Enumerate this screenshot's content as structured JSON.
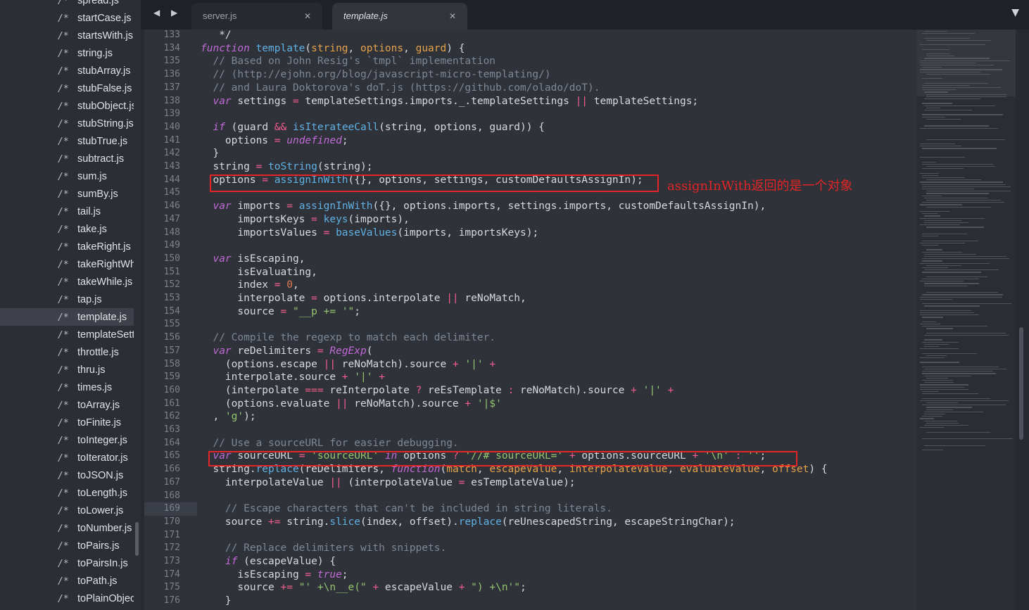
{
  "sidebar": {
    "items": [
      {
        "icon": "/*",
        "label": "spread.js"
      },
      {
        "icon": "/*",
        "label": "startCase.js"
      },
      {
        "icon": "/*",
        "label": "startsWith.js"
      },
      {
        "icon": "/*",
        "label": "string.js"
      },
      {
        "icon": "/*",
        "label": "stubArray.js"
      },
      {
        "icon": "/*",
        "label": "stubFalse.js"
      },
      {
        "icon": "/*",
        "label": "stubObject.js"
      },
      {
        "icon": "/*",
        "label": "stubString.js"
      },
      {
        "icon": "/*",
        "label": "stubTrue.js"
      },
      {
        "icon": "/*",
        "label": "subtract.js"
      },
      {
        "icon": "/*",
        "label": "sum.js"
      },
      {
        "icon": "/*",
        "label": "sumBy.js"
      },
      {
        "icon": "/*",
        "label": "tail.js"
      },
      {
        "icon": "/*",
        "label": "take.js"
      },
      {
        "icon": "/*",
        "label": "takeRight.js"
      },
      {
        "icon": "/*",
        "label": "takeRightWhile.js"
      },
      {
        "icon": "/*",
        "label": "takeWhile.js"
      },
      {
        "icon": "/*",
        "label": "tap.js"
      },
      {
        "icon": "/*",
        "label": "template.js",
        "active": true
      },
      {
        "icon": "/*",
        "label": "templateSettings.js"
      },
      {
        "icon": "/*",
        "label": "throttle.js"
      },
      {
        "icon": "/*",
        "label": "thru.js"
      },
      {
        "icon": "/*",
        "label": "times.js"
      },
      {
        "icon": "/*",
        "label": "toArray.js"
      },
      {
        "icon": "/*",
        "label": "toFinite.js"
      },
      {
        "icon": "/*",
        "label": "toInteger.js"
      },
      {
        "icon": "/*",
        "label": "toIterator.js"
      },
      {
        "icon": "/*",
        "label": "toJSON.js"
      },
      {
        "icon": "/*",
        "label": "toLength.js"
      },
      {
        "icon": "/*",
        "label": "toLower.js"
      },
      {
        "icon": "/*",
        "label": "toNumber.js"
      },
      {
        "icon": "/*",
        "label": "toPairs.js"
      },
      {
        "icon": "/*",
        "label": "toPairsIn.js"
      },
      {
        "icon": "/*",
        "label": "toPath.js"
      },
      {
        "icon": "/*",
        "label": "toPlainObject.js"
      }
    ]
  },
  "tabs": {
    "nav": "◀ ▶",
    "items": [
      {
        "label": "server.js",
        "close": "✕"
      },
      {
        "label": "template.js",
        "close": "✕",
        "active": true
      }
    ],
    "dropdown": "▼"
  },
  "editor": {
    "current_line": 169,
    "lines": [
      {
        "n": 133,
        "t": [
          [
            "",
            "   */"
          ]
        ]
      },
      {
        "n": 134,
        "t": [
          [
            "kw",
            "function"
          ],
          [
            "",
            " "
          ],
          [
            "fn",
            "template"
          ],
          [
            "",
            "("
          ],
          [
            "pa",
            "string"
          ],
          [
            "",
            ", "
          ],
          [
            "pa",
            "options"
          ],
          [
            "",
            ", "
          ],
          [
            "pa",
            "guard"
          ],
          [
            "",
            ") {"
          ]
        ]
      },
      {
        "n": 135,
        "t": [
          [
            "cm",
            "  // Based on John Resig's `tmpl` implementation"
          ]
        ]
      },
      {
        "n": 136,
        "t": [
          [
            "cm",
            "  // (http://ejohn.org/blog/javascript-micro-templating/)"
          ]
        ]
      },
      {
        "n": 137,
        "t": [
          [
            "cm",
            "  // and Laura Doktorova's doT.js (https://github.com/olado/doT)."
          ]
        ]
      },
      {
        "n": 138,
        "t": [
          [
            "",
            "  "
          ],
          [
            "kw",
            "var"
          ],
          [
            "",
            " settings "
          ],
          [
            "op",
            "="
          ],
          [
            "",
            " templateSettings.imports._.templateSettings "
          ],
          [
            "op",
            "||"
          ],
          [
            "",
            " templateSettings;"
          ]
        ]
      },
      {
        "n": 139,
        "t": []
      },
      {
        "n": 140,
        "t": [
          [
            "",
            "  "
          ],
          [
            "kw",
            "if"
          ],
          [
            "",
            " (guard "
          ],
          [
            "op",
            "&&"
          ],
          [
            "",
            " "
          ],
          [
            "fn",
            "isIterateeCall"
          ],
          [
            "",
            "(string, options, guard)) {"
          ]
        ]
      },
      {
        "n": 141,
        "t": [
          [
            "",
            "    options "
          ],
          [
            "op",
            "="
          ],
          [
            "",
            " "
          ],
          [
            "kw",
            "undefined"
          ],
          [
            "",
            ";"
          ]
        ]
      },
      {
        "n": 142,
        "t": [
          [
            "",
            "  }"
          ]
        ]
      },
      {
        "n": 143,
        "t": [
          [
            "",
            "  string "
          ],
          [
            "op",
            "="
          ],
          [
            "",
            " "
          ],
          [
            "fn",
            "toString"
          ],
          [
            "",
            "(string);"
          ]
        ]
      },
      {
        "n": 144,
        "t": [
          [
            "",
            "  options "
          ],
          [
            "op",
            "="
          ],
          [
            "",
            " "
          ],
          [
            "fn",
            "assignInWith"
          ],
          [
            "",
            "({}, options, settings, customDefaultsAssignIn);"
          ]
        ]
      },
      {
        "n": 145,
        "t": []
      },
      {
        "n": 146,
        "t": [
          [
            "",
            "  "
          ],
          [
            "kw",
            "var"
          ],
          [
            "",
            " imports "
          ],
          [
            "op",
            "="
          ],
          [
            "",
            " "
          ],
          [
            "fn",
            "assignInWith"
          ],
          [
            "",
            "({}, options.imports, settings.imports, customDefaultsAssignIn),"
          ]
        ]
      },
      {
        "n": 147,
        "t": [
          [
            "",
            "      importsKeys "
          ],
          [
            "op",
            "="
          ],
          [
            "",
            " "
          ],
          [
            "fn",
            "keys"
          ],
          [
            "",
            "(imports),"
          ]
        ]
      },
      {
        "n": 148,
        "t": [
          [
            "",
            "      importsValues "
          ],
          [
            "op",
            "="
          ],
          [
            "",
            " "
          ],
          [
            "fn",
            "baseValues"
          ],
          [
            "",
            "(imports, importsKeys);"
          ]
        ]
      },
      {
        "n": 149,
        "t": []
      },
      {
        "n": 150,
        "t": [
          [
            "",
            "  "
          ],
          [
            "kw",
            "var"
          ],
          [
            "",
            " isEscaping,"
          ]
        ]
      },
      {
        "n": 151,
        "t": [
          [
            "",
            "      isEvaluating,"
          ]
        ]
      },
      {
        "n": 152,
        "t": [
          [
            "",
            "      index "
          ],
          [
            "op",
            "="
          ],
          [
            "",
            " "
          ],
          [
            "nu",
            "0"
          ],
          [
            "",
            ","
          ]
        ]
      },
      {
        "n": 153,
        "t": [
          [
            "",
            "      interpolate "
          ],
          [
            "op",
            "="
          ],
          [
            "",
            " options.interpolate "
          ],
          [
            "op",
            "||"
          ],
          [
            "",
            " reNoMatch,"
          ]
        ]
      },
      {
        "n": 154,
        "t": [
          [
            "",
            "      source "
          ],
          [
            "op",
            "="
          ],
          [
            "",
            " "
          ],
          [
            "st",
            "\"__p += '\""
          ],
          [
            "",
            ";"
          ]
        ]
      },
      {
        "n": 155,
        "t": []
      },
      {
        "n": 156,
        "t": [
          [
            "cm",
            "  // Compile the regexp to match each delimiter."
          ]
        ]
      },
      {
        "n": 157,
        "t": [
          [
            "",
            "  "
          ],
          [
            "kw",
            "var"
          ],
          [
            "",
            " reDelimiters "
          ],
          [
            "op",
            "="
          ],
          [
            "",
            " "
          ],
          [
            "kw",
            "RegExp"
          ],
          [
            "",
            "("
          ]
        ]
      },
      {
        "n": 158,
        "t": [
          [
            "",
            "    (options.escape "
          ],
          [
            "op",
            "||"
          ],
          [
            "",
            " reNoMatch).source "
          ],
          [
            "op",
            "+"
          ],
          [
            "",
            " "
          ],
          [
            "st",
            "'|'"
          ],
          [
            "",
            " "
          ],
          [
            "op",
            "+"
          ]
        ]
      },
      {
        "n": 159,
        "t": [
          [
            "",
            "    interpolate.source "
          ],
          [
            "op",
            "+"
          ],
          [
            "",
            " "
          ],
          [
            "st",
            "'|'"
          ],
          [
            "",
            " "
          ],
          [
            "op",
            "+"
          ]
        ]
      },
      {
        "n": 160,
        "t": [
          [
            "",
            "    (interpolate "
          ],
          [
            "op",
            "==="
          ],
          [
            "",
            " reInterpolate "
          ],
          [
            "op",
            "?"
          ],
          [
            "",
            " reEsTemplate "
          ],
          [
            "op",
            ":"
          ],
          [
            "",
            " reNoMatch).source "
          ],
          [
            "op",
            "+"
          ],
          [
            "",
            " "
          ],
          [
            "st",
            "'|'"
          ],
          [
            "",
            " "
          ],
          [
            "op",
            "+"
          ]
        ]
      },
      {
        "n": 161,
        "t": [
          [
            "",
            "    (options.evaluate "
          ],
          [
            "op",
            "||"
          ],
          [
            "",
            " reNoMatch).source "
          ],
          [
            "op",
            "+"
          ],
          [
            "",
            " "
          ],
          [
            "st",
            "'|$'"
          ]
        ]
      },
      {
        "n": 162,
        "t": [
          [
            "",
            "  , "
          ],
          [
            "st",
            "'g'"
          ],
          [
            "",
            ");"
          ]
        ]
      },
      {
        "n": 163,
        "t": []
      },
      {
        "n": 164,
        "t": [
          [
            "cm",
            "  // Use a sourceURL for easier debugging."
          ]
        ]
      },
      {
        "n": 165,
        "t": [
          [
            "",
            "  "
          ],
          [
            "kw",
            "var"
          ],
          [
            "",
            " sourceURL "
          ],
          [
            "op",
            "="
          ],
          [
            "",
            " "
          ],
          [
            "st",
            "'sourceURL'"
          ],
          [
            "",
            " "
          ],
          [
            "kw",
            "in"
          ],
          [
            "",
            " options "
          ],
          [
            "op",
            "?"
          ],
          [
            "",
            " "
          ],
          [
            "st",
            "'//# sourceURL='"
          ],
          [
            "",
            " "
          ],
          [
            "op",
            "+"
          ],
          [
            "",
            " options.sourceURL "
          ],
          [
            "op",
            "+"
          ],
          [
            "",
            " "
          ],
          [
            "st",
            "'\\n'"
          ],
          [
            "",
            " "
          ],
          [
            "op",
            ":"
          ],
          [
            "",
            " "
          ],
          [
            "st",
            "''"
          ],
          [
            "",
            ";"
          ]
        ]
      },
      {
        "n": 166,
        "t": [
          [
            "",
            "  string."
          ],
          [
            "fn",
            "replace"
          ],
          [
            "",
            "(reDelimiters, "
          ],
          [
            "kw",
            "function"
          ],
          [
            "",
            "("
          ],
          [
            "pa",
            "match"
          ],
          [
            "",
            ", "
          ],
          [
            "pa",
            "escapeValue"
          ],
          [
            "",
            ", "
          ],
          [
            "pa",
            "interpolateValue"
          ],
          [
            "",
            ", "
          ],
          [
            "pa",
            "evaluateValue"
          ],
          [
            "",
            ", "
          ],
          [
            "pa",
            "offset"
          ],
          [
            "",
            ") {"
          ]
        ]
      },
      {
        "n": 167,
        "t": [
          [
            "",
            "    interpolateValue "
          ],
          [
            "op",
            "||"
          ],
          [
            "",
            " (interpolateValue "
          ],
          [
            "op",
            "="
          ],
          [
            "",
            " esTemplateValue);"
          ]
        ]
      },
      {
        "n": 168,
        "t": []
      },
      {
        "n": 169,
        "t": [
          [
            "cm",
            "    // Escape characters that can't be included in string literals."
          ]
        ]
      },
      {
        "n": 170,
        "t": [
          [
            "",
            "    source "
          ],
          [
            "op",
            "+="
          ],
          [
            "",
            " string."
          ],
          [
            "fn",
            "slice"
          ],
          [
            "",
            "(index, offset)."
          ],
          [
            "fn",
            "replace"
          ],
          [
            "",
            "(reUnescapedString, escapeStringChar);"
          ]
        ]
      },
      {
        "n": 171,
        "t": []
      },
      {
        "n": 172,
        "t": [
          [
            "cm",
            "    // Replace delimiters with snippets."
          ]
        ]
      },
      {
        "n": 173,
        "t": [
          [
            "",
            "    "
          ],
          [
            "kw",
            "if"
          ],
          [
            "",
            " (escapeValue) {"
          ]
        ]
      },
      {
        "n": 174,
        "t": [
          [
            "",
            "      isEscaping "
          ],
          [
            "op",
            "="
          ],
          [
            "",
            " "
          ],
          [
            "kw",
            "true"
          ],
          [
            "",
            ";"
          ]
        ]
      },
      {
        "n": 175,
        "t": [
          [
            "",
            "      source "
          ],
          [
            "op",
            "+="
          ],
          [
            "",
            " "
          ],
          [
            "st",
            "\"' +\\n__e(\""
          ],
          [
            "",
            " "
          ],
          [
            "op",
            "+"
          ],
          [
            "",
            " escapeValue "
          ],
          [
            "op",
            "+"
          ],
          [
            "",
            " "
          ],
          [
            "st",
            "\") +\\n'\""
          ],
          [
            "",
            ";"
          ]
        ]
      },
      {
        "n": 176,
        "t": [
          [
            "",
            "    }"
          ]
        ]
      }
    ]
  },
  "annotation": {
    "text": "assignInWith返回的是一个对象",
    "color": "#e32527"
  }
}
